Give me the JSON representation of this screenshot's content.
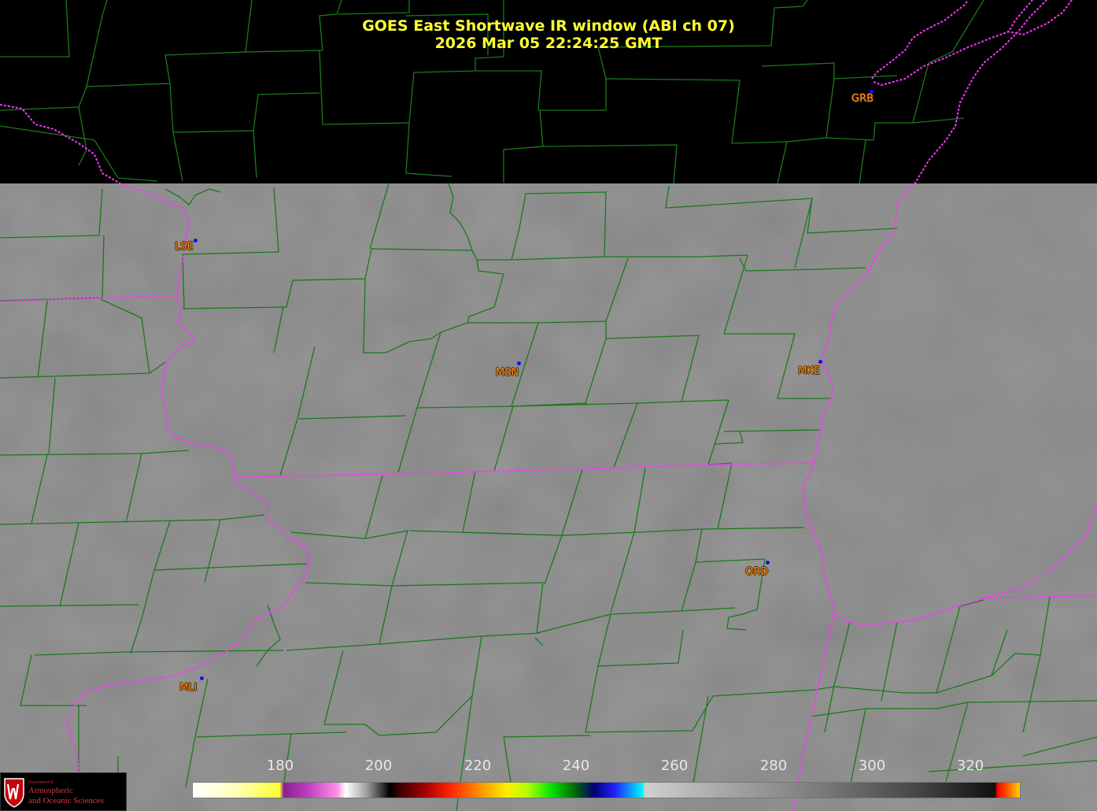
{
  "header": {
    "title_line1": "GOES East Shortwave IR window (ABI ch 07)",
    "title_line2": "2026 Mar 05  22:24:25 GMT"
  },
  "cities": [
    {
      "id": "grb",
      "label": "GRB"
    },
    {
      "id": "lse",
      "label": "LSE"
    },
    {
      "id": "msn",
      "label": "MSN"
    },
    {
      "id": "mke",
      "label": "MKE"
    },
    {
      "id": "ord",
      "label": "ORD"
    },
    {
      "id": "mli",
      "label": "MLI"
    }
  ],
  "colorbar": {
    "ticks": [
      "180",
      "200",
      "220",
      "240",
      "260",
      "280",
      "300",
      "320"
    ]
  },
  "logo": {
    "dept": "Department of",
    "line1": "Atmospheric",
    "line2": "and Oceanic Sciences"
  },
  "colors": {
    "title": "#ffff33",
    "city_label": "#ff8c1a",
    "county_lines": "#1a7a1a",
    "state_lines": "#ff33ff",
    "city_dot": "#1010ff"
  }
}
